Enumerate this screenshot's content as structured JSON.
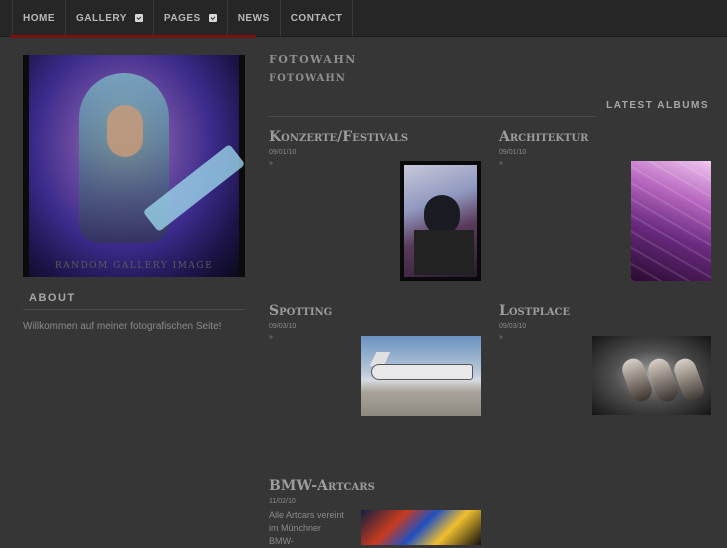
{
  "nav": {
    "items": [
      {
        "label": "HOME",
        "dropdown": false
      },
      {
        "label": "GALLERY",
        "dropdown": true
      },
      {
        "label": "PAGES",
        "dropdown": true
      },
      {
        "label": "NEWS",
        "dropdown": false
      },
      {
        "label": "CONTACT",
        "dropdown": false
      }
    ]
  },
  "sidebar": {
    "featured_caption": "RANDOM GALLERY IMAGE",
    "about_heading": "ABOUT",
    "about_text": "Willkommen auf meiner fotografischen Seite!"
  },
  "header": {
    "site_title": "FOTOWAHN",
    "site_subtitle": "FOTOWAHN",
    "latest_heading": "LATEST ALBUMS"
  },
  "albums": [
    {
      "title": "Konzerte/Festivals",
      "date": "09/01/10",
      "more": "»",
      "desc": ""
    },
    {
      "title": "Architektur",
      "date": "09/01/10",
      "more": "»",
      "desc": ""
    },
    {
      "title": "Spotting",
      "date": "09/03/10",
      "more": "»",
      "desc": ""
    },
    {
      "title": "Lostplace",
      "date": "09/03/10",
      "more": "»",
      "desc": ""
    },
    {
      "title": "BMW-Artcars",
      "date": "11/02/10",
      "more": "",
      "desc": "Alle Artcars vereint im Münchner BMW-"
    }
  ],
  "colors": {
    "background": "#363636",
    "nav_bg": "#262626",
    "nav_accent": "#7a1010"
  }
}
